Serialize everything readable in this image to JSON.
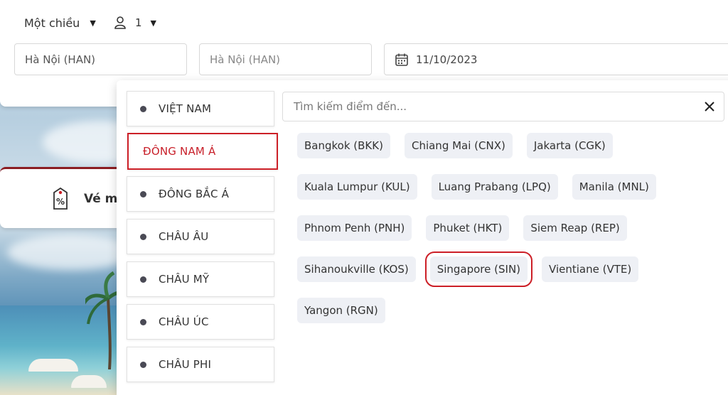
{
  "search": {
    "trip_type": "Một chiều",
    "passengers": "1",
    "from": "Hà Nội (HAN)",
    "to": "Hà Nội (HAN)",
    "date": "11/10/2023"
  },
  "promo": {
    "text": "Vé m"
  },
  "dropdown": {
    "search_placeholder": "Tìm kiếm điểm đến...",
    "regions": [
      {
        "label": "VIỆT NAM"
      },
      {
        "label": "ĐÔNG NAM Á",
        "active": true
      },
      {
        "label": "ĐÔNG BẮC Á"
      },
      {
        "label": "CHÂU ÂU"
      },
      {
        "label": "CHÂU MỸ"
      },
      {
        "label": "CHÂU ÚC"
      },
      {
        "label": "CHÂU PHI"
      }
    ],
    "destinations": [
      [
        "Bangkok (BKK)",
        "Chiang Mai (CNX)",
        "Jakarta (CGK)"
      ],
      [
        "Kuala Lumpur (KUL)",
        "Luang Prabang (LPQ)",
        "Manila (MNL)"
      ],
      [
        "Phnom Penh (PNH)",
        "Phuket (HKT)",
        "Siem Reap (REP)"
      ],
      [
        "Sihanoukville (KOS)",
        "Singapore (SIN)",
        "Vientiane (VTE)"
      ],
      [
        "Yangon (RGN)"
      ]
    ],
    "selected_destination": "Singapore (SIN)"
  },
  "colors": {
    "accent_red": "#cc1f27",
    "chip_bg": "#eef0f5"
  }
}
